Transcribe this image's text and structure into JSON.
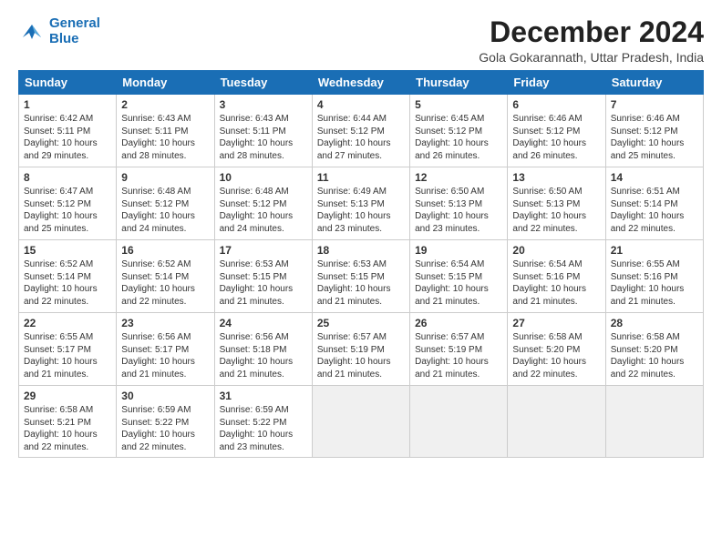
{
  "logo": {
    "line1": "General",
    "line2": "Blue"
  },
  "title": "December 2024",
  "location": "Gola Gokarannath, Uttar Pradesh, India",
  "headers": [
    "Sunday",
    "Monday",
    "Tuesday",
    "Wednesday",
    "Thursday",
    "Friday",
    "Saturday"
  ],
  "weeks": [
    [
      {
        "day": "1",
        "info": "Sunrise: 6:42 AM\nSunset: 5:11 PM\nDaylight: 10 hours\nand 29 minutes."
      },
      {
        "day": "2",
        "info": "Sunrise: 6:43 AM\nSunset: 5:11 PM\nDaylight: 10 hours\nand 28 minutes."
      },
      {
        "day": "3",
        "info": "Sunrise: 6:43 AM\nSunset: 5:11 PM\nDaylight: 10 hours\nand 28 minutes."
      },
      {
        "day": "4",
        "info": "Sunrise: 6:44 AM\nSunset: 5:12 PM\nDaylight: 10 hours\nand 27 minutes."
      },
      {
        "day": "5",
        "info": "Sunrise: 6:45 AM\nSunset: 5:12 PM\nDaylight: 10 hours\nand 26 minutes."
      },
      {
        "day": "6",
        "info": "Sunrise: 6:46 AM\nSunset: 5:12 PM\nDaylight: 10 hours\nand 26 minutes."
      },
      {
        "day": "7",
        "info": "Sunrise: 6:46 AM\nSunset: 5:12 PM\nDaylight: 10 hours\nand 25 minutes."
      }
    ],
    [
      {
        "day": "8",
        "info": "Sunrise: 6:47 AM\nSunset: 5:12 PM\nDaylight: 10 hours\nand 25 minutes."
      },
      {
        "day": "9",
        "info": "Sunrise: 6:48 AM\nSunset: 5:12 PM\nDaylight: 10 hours\nand 24 minutes."
      },
      {
        "day": "10",
        "info": "Sunrise: 6:48 AM\nSunset: 5:12 PM\nDaylight: 10 hours\nand 24 minutes."
      },
      {
        "day": "11",
        "info": "Sunrise: 6:49 AM\nSunset: 5:13 PM\nDaylight: 10 hours\nand 23 minutes."
      },
      {
        "day": "12",
        "info": "Sunrise: 6:50 AM\nSunset: 5:13 PM\nDaylight: 10 hours\nand 23 minutes."
      },
      {
        "day": "13",
        "info": "Sunrise: 6:50 AM\nSunset: 5:13 PM\nDaylight: 10 hours\nand 22 minutes."
      },
      {
        "day": "14",
        "info": "Sunrise: 6:51 AM\nSunset: 5:14 PM\nDaylight: 10 hours\nand 22 minutes."
      }
    ],
    [
      {
        "day": "15",
        "info": "Sunrise: 6:52 AM\nSunset: 5:14 PM\nDaylight: 10 hours\nand 22 minutes."
      },
      {
        "day": "16",
        "info": "Sunrise: 6:52 AM\nSunset: 5:14 PM\nDaylight: 10 hours\nand 22 minutes."
      },
      {
        "day": "17",
        "info": "Sunrise: 6:53 AM\nSunset: 5:15 PM\nDaylight: 10 hours\nand 21 minutes."
      },
      {
        "day": "18",
        "info": "Sunrise: 6:53 AM\nSunset: 5:15 PM\nDaylight: 10 hours\nand 21 minutes."
      },
      {
        "day": "19",
        "info": "Sunrise: 6:54 AM\nSunset: 5:15 PM\nDaylight: 10 hours\nand 21 minutes."
      },
      {
        "day": "20",
        "info": "Sunrise: 6:54 AM\nSunset: 5:16 PM\nDaylight: 10 hours\nand 21 minutes."
      },
      {
        "day": "21",
        "info": "Sunrise: 6:55 AM\nSunset: 5:16 PM\nDaylight: 10 hours\nand 21 minutes."
      }
    ],
    [
      {
        "day": "22",
        "info": "Sunrise: 6:55 AM\nSunset: 5:17 PM\nDaylight: 10 hours\nand 21 minutes."
      },
      {
        "day": "23",
        "info": "Sunrise: 6:56 AM\nSunset: 5:17 PM\nDaylight: 10 hours\nand 21 minutes."
      },
      {
        "day": "24",
        "info": "Sunrise: 6:56 AM\nSunset: 5:18 PM\nDaylight: 10 hours\nand 21 minutes."
      },
      {
        "day": "25",
        "info": "Sunrise: 6:57 AM\nSunset: 5:19 PM\nDaylight: 10 hours\nand 21 minutes."
      },
      {
        "day": "26",
        "info": "Sunrise: 6:57 AM\nSunset: 5:19 PM\nDaylight: 10 hours\nand 21 minutes."
      },
      {
        "day": "27",
        "info": "Sunrise: 6:58 AM\nSunset: 5:20 PM\nDaylight: 10 hours\nand 22 minutes."
      },
      {
        "day": "28",
        "info": "Sunrise: 6:58 AM\nSunset: 5:20 PM\nDaylight: 10 hours\nand 22 minutes."
      }
    ],
    [
      {
        "day": "29",
        "info": "Sunrise: 6:58 AM\nSunset: 5:21 PM\nDaylight: 10 hours\nand 22 minutes."
      },
      {
        "day": "30",
        "info": "Sunrise: 6:59 AM\nSunset: 5:22 PM\nDaylight: 10 hours\nand 22 minutes."
      },
      {
        "day": "31",
        "info": "Sunrise: 6:59 AM\nSunset: 5:22 PM\nDaylight: 10 hours\nand 23 minutes."
      },
      {
        "day": "",
        "info": ""
      },
      {
        "day": "",
        "info": ""
      },
      {
        "day": "",
        "info": ""
      },
      {
        "day": "",
        "info": ""
      }
    ]
  ]
}
